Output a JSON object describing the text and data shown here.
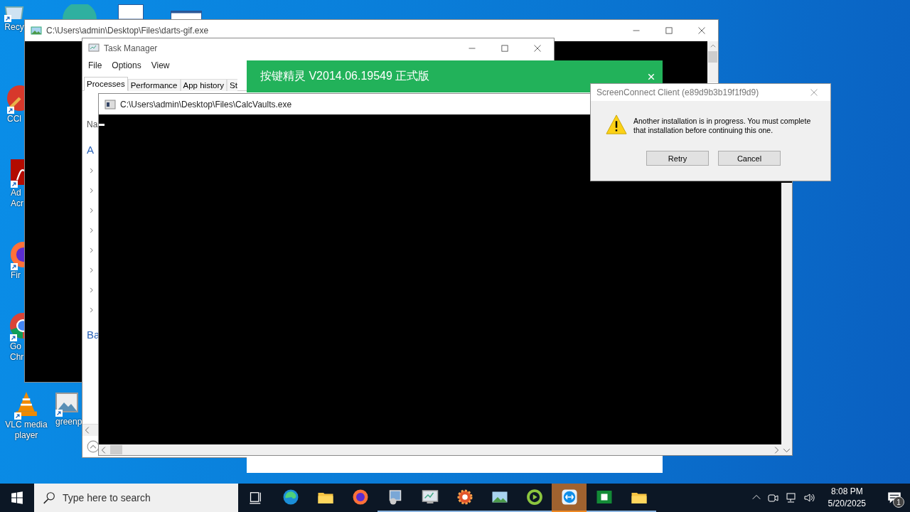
{
  "desktop_icons": [
    {
      "kind": "recycle-bin",
      "label_lines": [
        "Recy"
      ]
    },
    {
      "kind": "brush",
      "label_lines": [
        "CCl"
      ]
    },
    {
      "kind": "pdf",
      "label_lines": [
        "Ad",
        "Acr"
      ]
    },
    {
      "kind": "firefox",
      "label_lines": [
        "Fir"
      ]
    },
    {
      "kind": "chrome",
      "label_lines": [
        "Go",
        "Chr"
      ]
    },
    {
      "kind": "cone",
      "label_lines": [
        "VLC media",
        "player"
      ]
    },
    {
      "kind": "image",
      "label_lines": [
        "greenp"
      ]
    }
  ],
  "darts_window": {
    "title": "C:\\Users\\admin\\Desktop\\Files\\darts-gif.exe"
  },
  "task_manager": {
    "title": "Task Manager",
    "menu": [
      "File",
      "Options",
      "View"
    ],
    "tabs": [
      {
        "label": "Processes",
        "selected": true
      },
      {
        "label": "Performance",
        "selected": false
      },
      {
        "label": "App history",
        "selected": false
      },
      {
        "label": "St",
        "selected": false
      }
    ],
    "column_header": "Na",
    "first_group": "A",
    "rows": [
      {
        "expanded": false
      },
      {
        "expanded": false
      },
      {
        "expanded": false
      },
      {
        "expanded": false
      },
      {
        "expanded": false
      },
      {
        "expanded": false
      },
      {
        "expanded": false
      },
      {
        "expanded": false
      }
    ],
    "second_group": "Ba"
  },
  "banner_window": {
    "title": "按键精灵 V2014.06.19549 正式版"
  },
  "console_window": {
    "title": "C:\\Users\\admin\\Desktop\\Files\\CalcVaults.exe"
  },
  "dialog": {
    "title": "ScreenConnect Client (e89d9b3b19f1f9d9)",
    "message": "Another installation is in progress. You must complete that installation before continuing this one.",
    "buttons": [
      "Retry",
      "Cancel"
    ]
  },
  "taskbar": {
    "search": {
      "placeholder": "Type here to search"
    },
    "apps": [
      {
        "kind": "edge",
        "running": false,
        "selected": false
      },
      {
        "kind": "folder",
        "running": false,
        "selected": false
      },
      {
        "kind": "firefox",
        "running": false,
        "selected": false
      },
      {
        "kind": "installer",
        "running": true,
        "selected": false
      },
      {
        "kind": "monitor",
        "running": true,
        "selected": false
      },
      {
        "kind": "gear",
        "running": true,
        "selected": false
      },
      {
        "kind": "image",
        "running": true,
        "selected": false
      },
      {
        "kind": "play",
        "running": true,
        "selected": false
      },
      {
        "kind": "remote",
        "running": true,
        "selected": true
      },
      {
        "kind": "sheet",
        "running": true,
        "selected": false
      },
      {
        "kind": "folder",
        "running": true,
        "selected": false
      }
    ],
    "clock": {
      "time": "8:08 PM",
      "date": "5/20/2025"
    },
    "notifications": {
      "count": "1"
    }
  }
}
